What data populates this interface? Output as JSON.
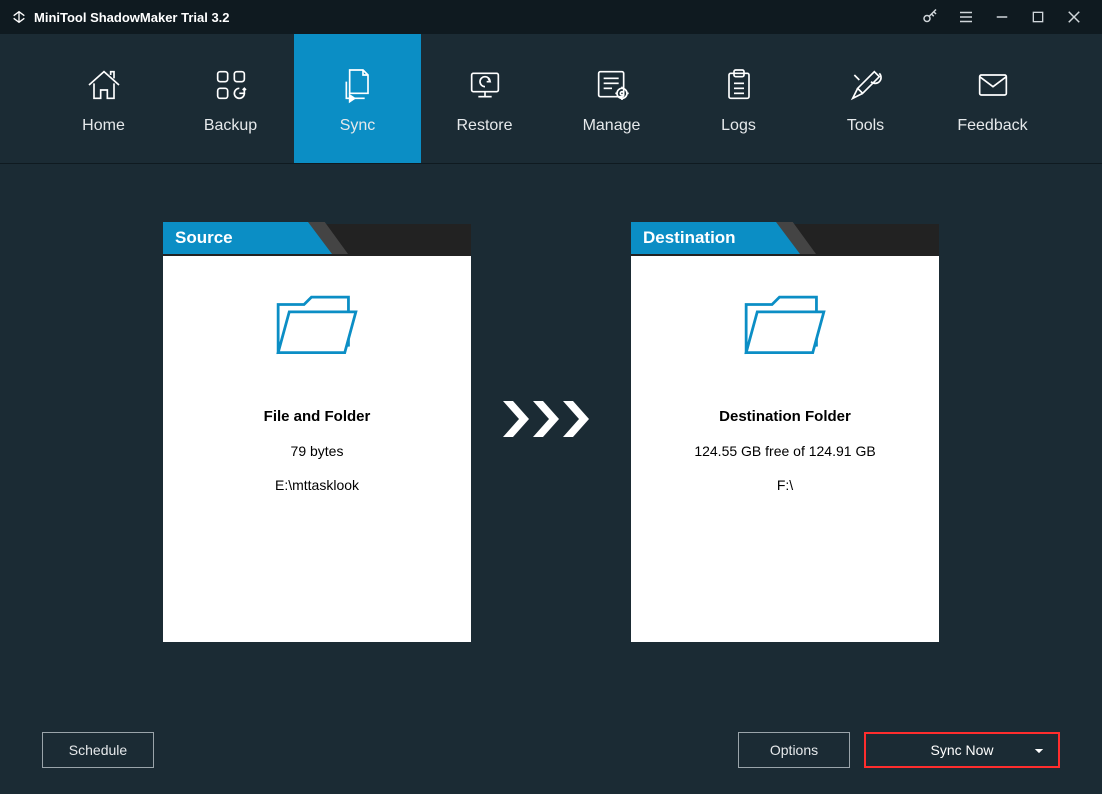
{
  "titlebar": {
    "title": "MiniTool ShadowMaker Trial 3.2"
  },
  "nav": {
    "items": [
      {
        "label": "Home"
      },
      {
        "label": "Backup"
      },
      {
        "label": "Sync"
      },
      {
        "label": "Restore"
      },
      {
        "label": "Manage"
      },
      {
        "label": "Logs"
      },
      {
        "label": "Tools"
      },
      {
        "label": "Feedback"
      }
    ],
    "active_index": 2
  },
  "source": {
    "header": "Source",
    "title": "File and Folder",
    "size": "79 bytes",
    "path": "E:\\mttasklook"
  },
  "destination": {
    "header": "Destination",
    "title": "Destination Folder",
    "size": "124.55 GB free of 124.91 GB",
    "path": "F:\\"
  },
  "footer": {
    "schedule": "Schedule",
    "options": "Options",
    "sync_now": "Sync Now"
  }
}
